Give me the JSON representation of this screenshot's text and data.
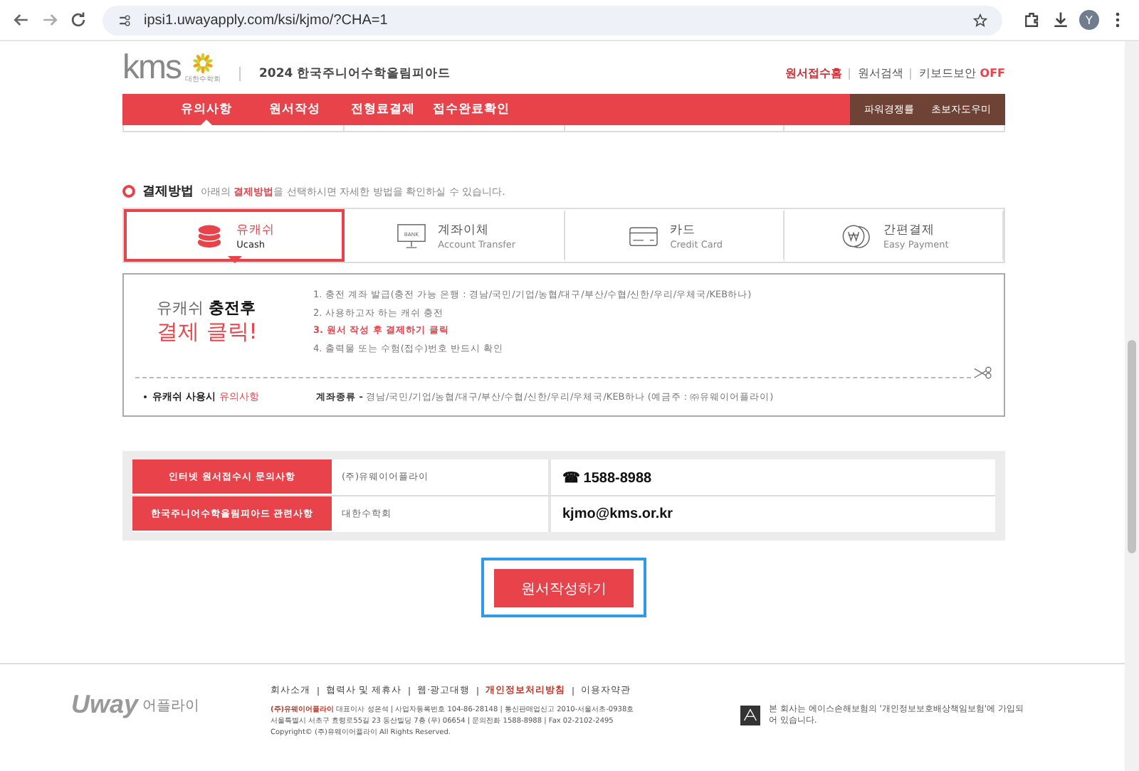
{
  "browser": {
    "url": "ipsi1.uwayapply.com/ksi/kjmo/?CHA=1",
    "avatar": "Y"
  },
  "header": {
    "logo": "kms",
    "logo_sub": "대한수학회",
    "title": "2024 한국주니어수학올림피아드",
    "links": [
      {
        "label": "원서접수홈",
        "highlight": true
      },
      {
        "label": "원서검색",
        "highlight": false
      },
      {
        "label": "키보드보안",
        "highlight": false
      }
    ],
    "keyboard_state": "OFF"
  },
  "nav": {
    "items": [
      {
        "label": "유의사항",
        "selected": true
      },
      {
        "label": "원서작성",
        "selected": false
      },
      {
        "label": "전형료결제",
        "selected": false
      },
      {
        "label": "접수완료확인",
        "selected": false
      }
    ],
    "side_items": [
      "파워경쟁률",
      "초보자도우미"
    ]
  },
  "payment": {
    "title": "결제방법",
    "desc": "아래의 **결제방법**을 선택하시면 자세한 방법을 확인하실 수 있습니다.",
    "methods": [
      {
        "kind": "ucash",
        "label": "유캐쉬",
        "sub": "Ucash",
        "selected": true
      },
      {
        "kind": "bank",
        "label": "계좌이체",
        "sub": "Account Transfer",
        "selected": false,
        "icon_text": "BANK"
      },
      {
        "kind": "card",
        "label": "카드",
        "sub": "Credit Card",
        "selected": false
      },
      {
        "kind": "easy",
        "label": "간편결제",
        "sub": "Easy Payment",
        "selected": false
      }
    ],
    "promo_line1": "유캐쉬",
    "promo_line1_bold": "충전후",
    "promo_line2": "결제 클릭!",
    "steps": [
      {
        "text": "1. 충전 계좌 발급(충전 가능 은행 : 경남/국민/기업/농협/대구/부산/수협/신한/우리/우체국/KEB하나)",
        "highlight": false
      },
      {
        "text": "2. 사용하고자 하는 캐쉬 충전",
        "highlight": false
      },
      {
        "text": "3. 원서 작성 후 결제하기 클릭",
        "highlight": true
      },
      {
        "text": "4. 출력물 또는 수험(접수)번호 반드시 확인",
        "highlight": false
      }
    ],
    "notice_label": "유캐쉬 사용시",
    "notice_label_red": "유의사항",
    "notice_text": "**계좌종류 -** 경남/국민/기업/농협/대구/부산/수협/신한/우리/우체국/KEB하나 (예금주 : ㈜유웨이어플라이)"
  },
  "contacts": [
    {
      "label": "인터넷 원서접수시 문의사항",
      "org": "(주)유웨이어플라이",
      "value": "1588-8988",
      "kind": "phone",
      "phone_icon": "☎"
    },
    {
      "label": "한국주니어수학올림피아드 관련사항",
      "org": "대한수학회",
      "value": "kjmo@kms.or.kr",
      "kind": "email"
    }
  ],
  "submit_button": "원서작성하기",
  "footer": {
    "logo": "Uway",
    "logo_sub": "어플라이",
    "links": [
      {
        "label": "회사소개",
        "highlight": false
      },
      {
        "label": "협력사 및 제휴사",
        "highlight": false
      },
      {
        "label": "웹·광고대행",
        "highlight": false
      },
      {
        "label": "개인정보처리방침",
        "highlight": true
      },
      {
        "label": "이용자약관",
        "highlight": false
      }
    ],
    "company": "(주)유웨이어플라이",
    "info1": "대표이사 성은석 | 사업자등록번호 104-86-28148 | 통신판매업신고 2010-서울서초-0938호",
    "info2": "서울특별시 서초구 효령로55길 23 동산빌딩 7층 (우) 06654 | 문의전화 1588-8988 | Fax 02-2102-2495",
    "copyright": "Copyright© (주)유웨이어플라이 All Rights Reserved.",
    "cert": "본 회사는 에이스손해보험의 '개인정보보호배상책임보험'에 가입되어 있습니다."
  }
}
